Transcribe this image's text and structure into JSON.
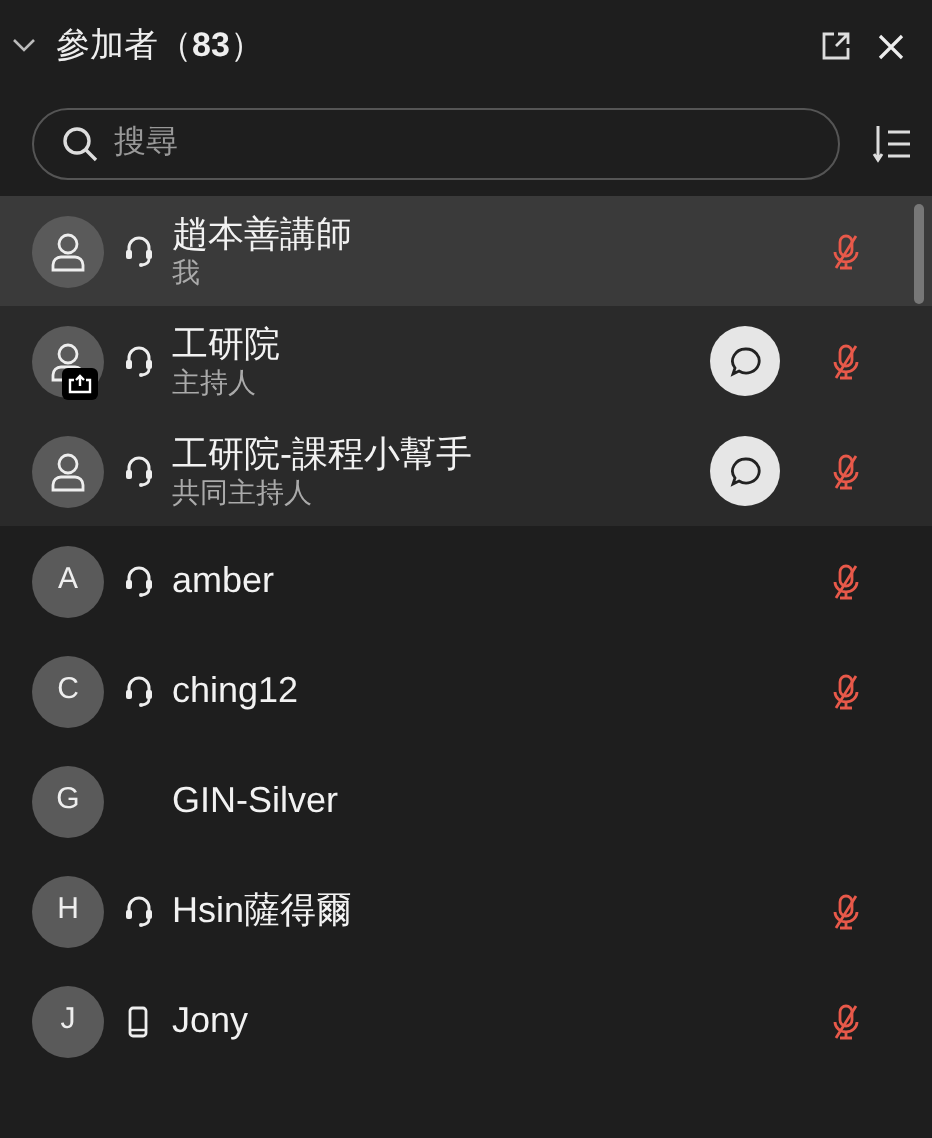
{
  "header": {
    "title": "參加者（**83**）"
  },
  "search": {
    "placeholder": "搜尋"
  },
  "participants": [
    {
      "kind": "me",
      "name": "趙本善講師",
      "subtitle": "我",
      "avatar": {
        "kind": "person"
      },
      "device": {
        "kind": "headset"
      },
      "sharing": false,
      "chat": false,
      "muted": true
    },
    {
      "kind": "host",
      "name": "工研院",
      "subtitle": "主持人",
      "avatar": {
        "kind": "person"
      },
      "device": {
        "kind": "headset"
      },
      "sharing": true,
      "chat": true,
      "muted": true
    },
    {
      "kind": "host",
      "name": "工研院-課程小幫手",
      "subtitle": "共同主持人",
      "avatar": {
        "kind": "person"
      },
      "device": {
        "kind": "headset"
      },
      "sharing": false,
      "chat": true,
      "muted": true
    },
    {
      "kind": "attendee",
      "name": "amber",
      "avatar": {
        "kind": "letter",
        "initial": "A"
      },
      "device": {
        "kind": "headset"
      },
      "sharing": false,
      "chat": false,
      "muted": true
    },
    {
      "kind": "attendee",
      "name": "ching12",
      "avatar": {
        "kind": "letter",
        "initial": "C"
      },
      "device": {
        "kind": "headset"
      },
      "sharing": false,
      "chat": false,
      "muted": true
    },
    {
      "kind": "attendee",
      "name": "GIN-Silver",
      "avatar": {
        "kind": "letter",
        "initial": "G"
      },
      "sharing": false,
      "chat": false,
      "muted": false
    },
    {
      "kind": "attendee",
      "name": "Hsin薩得爾",
      "avatar": {
        "kind": "letter",
        "initial": "H"
      },
      "device": {
        "kind": "headset"
      },
      "sharing": false,
      "chat": false,
      "muted": true
    },
    {
      "kind": "attendee",
      "name": "Jony",
      "avatar": {
        "kind": "letter",
        "initial": "J"
      },
      "device": {
        "kind": "phone"
      },
      "sharing": false,
      "chat": false,
      "muted": true
    }
  ]
}
